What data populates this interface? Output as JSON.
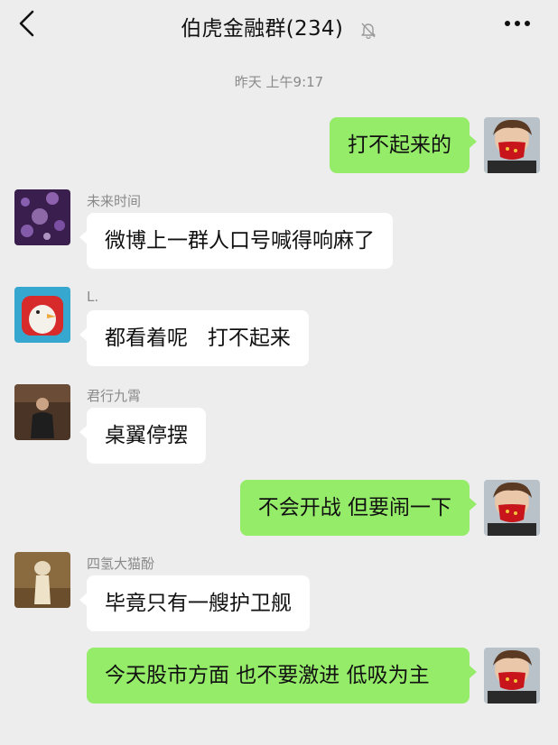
{
  "header": {
    "title": "伯虎金融群(234)",
    "back_icon": "chevron-left-icon",
    "mute_icon": "bell-muted-icon",
    "more_icon": "more-dots-icon"
  },
  "timestamp": "昨天 上午9:17",
  "messages": [
    {
      "direction": "out",
      "sender": "",
      "text": "打不起来的"
    },
    {
      "direction": "in",
      "sender": "未来时间",
      "text": "微博上一群人口号喊得响麻了"
    },
    {
      "direction": "in",
      "sender": "L.",
      "text": "都看着呢   打不起来"
    },
    {
      "direction": "in",
      "sender": "君行九霄",
      "text": "桌翼停摆"
    },
    {
      "direction": "out",
      "sender": "",
      "text": "不会开战 但要闹一下"
    },
    {
      "direction": "in",
      "sender": "四氢大猫酚",
      "text": "毕竟只有一艘护卫舰"
    },
    {
      "direction": "out",
      "sender": "",
      "text": "今天股市方面 也不要激进 低吸为主"
    }
  ],
  "colors": {
    "background": "#ededed",
    "outgoing_bubble": "#95ec69",
    "incoming_bubble": "#ffffff",
    "meta_text": "#8a8a8a"
  }
}
